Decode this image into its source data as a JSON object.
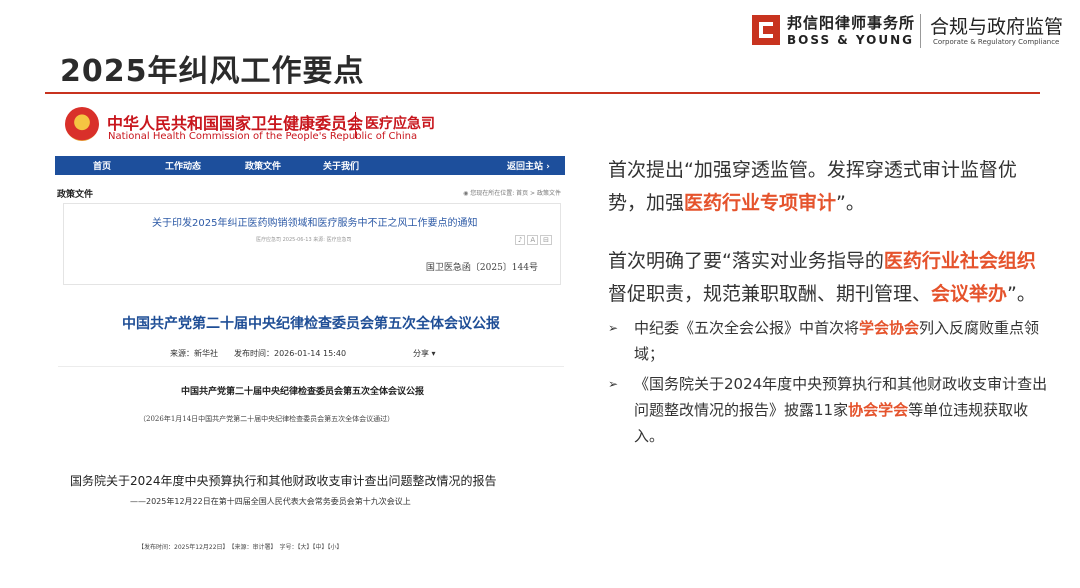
{
  "header": {
    "title": "2025年纠风工作要点",
    "logo_cn": "邦信阳律师事务所",
    "logo_en": "BOSS & YOUNG",
    "logo_dept": "合规与政府监管",
    "logo_dept_en": "Corporate & Regulatory Compliance"
  },
  "nhc": {
    "name": "中华人民共和国国家卫生健康委员会",
    "name_en": "National Health Commission of the People's Republic of China",
    "dept": "医疗应急司",
    "nav": [
      "首页",
      "工作动态",
      "政策文件",
      "关于我们",
      "返回主站 ›"
    ],
    "section": "政策文件",
    "location": "◉ 您现在所在位置: 首页 > 政策文件",
    "notice_title": "关于印发2025年纠正医药购销领域和医疗服务中不正之风工作要点的通知",
    "notice_meta": "医疗应急司    2025-06-13    来源: 医疗应急司",
    "icons": [
      "♪",
      "A",
      "⊟"
    ],
    "doc_no": "国卫医急函〔2025〕144号"
  },
  "ccdi": {
    "title": "中国共产党第二十届中央纪律检查委员会第五次全体会议公报",
    "meta": "来源：新华社　　发布时间：2026-01-14 15:40",
    "share": "分享 ▾",
    "subtitle": "中国共产党第二十届中央纪律检查委员会第五次全体会议公报",
    "note": "（2026年1月14日中国共产党第二十届中央纪律检查委员会第五次全体会议通过）"
  },
  "state_council": {
    "title": "国务院关于2024年度中央预算执行和其他财政收支审计查出问题整改情况的报告",
    "subtitle": "——2025年12月22日在第十四届全国人民代表大会常务委员会第十九次会议上",
    "meta": "【发布时间：2025年12月22日】　【来源：审计署】　字号：【大】【中】【小】"
  },
  "right": {
    "para1": [
      {
        "t": "首次提出“加强穿透监管。发挥穿透式审计监督优势，加强",
        "hl": false
      },
      {
        "t": "医药行业专项审计",
        "hl": true
      },
      {
        "t": "”。",
        "hl": false
      }
    ],
    "para2": [
      {
        "t": "首次明确了要“落实对业务指导的",
        "hl": false
      },
      {
        "t": "医药行业社会组织",
        "hl": true
      },
      {
        "t": "督促职责，规范兼职取酬、期刊管理、",
        "hl": false
      },
      {
        "t": "会议举办",
        "hl": true
      },
      {
        "t": "”。",
        "hl": false
      }
    ],
    "bullet_marker": "➢",
    "bullets": [
      [
        {
          "t": "中纪委《五次全会公报》中首次将",
          "hl": false
        },
        {
          "t": "学会协会",
          "hl": true
        },
        {
          "t": "列入反腐败重点领域；",
          "hl": false
        }
      ],
      [
        {
          "t": "《国务院关于2024年度中央预算执行和其他财政收支审计查出问题整改情况的报告》披露11家",
          "hl": false
        },
        {
          "t": "协会学会",
          "hl": true
        },
        {
          "t": "等单位违规获取收入。",
          "hl": false
        }
      ]
    ]
  },
  "colors": {
    "accent": "#c8331f",
    "highlight": "#e5532c",
    "nhc_red": "#c8161d",
    "nav_blue": "#1d4f9c",
    "ccdi_blue": "#1f4e96"
  }
}
